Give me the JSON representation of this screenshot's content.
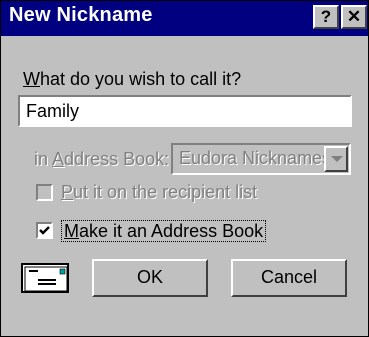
{
  "window": {
    "title": "New Nickname",
    "help_button": "?",
    "close_button": "✕"
  },
  "prompt": {
    "mnemonic": "W",
    "rest": "hat do you wish to call it?"
  },
  "name_input": {
    "value": "Family"
  },
  "address_book": {
    "label_prefix": "in ",
    "label_mnemonic": "A",
    "label_rest": "ddress Book:",
    "selected": "Eudora Nicknames"
  },
  "options": {
    "recipient_list": {
      "mnemonic": "P",
      "rest": "ut it on the recipient list",
      "checked": false,
      "enabled": false
    },
    "make_address_book": {
      "mnemonic": "M",
      "rest": "ake it an Address Book",
      "checked": true,
      "enabled": true
    }
  },
  "buttons": {
    "ok": "OK",
    "cancel": "Cancel"
  },
  "icons": {
    "envelope": "envelope-icon"
  }
}
